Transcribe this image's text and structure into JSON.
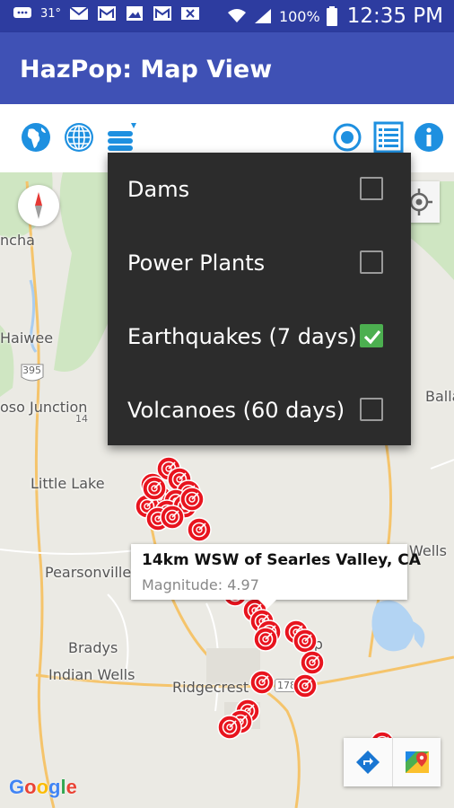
{
  "status_bar": {
    "temperature": "31°",
    "battery": "100%",
    "time": "12:35 PM"
  },
  "app_bar": {
    "title": "HazPop: Map View"
  },
  "toolbar": {
    "left_icons": [
      "globe-africa-icon",
      "globe-grid-icon",
      "layers-icon"
    ],
    "right_icons": [
      "target-icon",
      "list-icon",
      "info-icon"
    ],
    "accent_color": "#1e90e0"
  },
  "layers_menu": {
    "items": [
      {
        "label": "Dams",
        "checked": false
      },
      {
        "label": "Power Plants",
        "checked": false
      },
      {
        "label": "Earthquakes (7 days)",
        "checked": true
      },
      {
        "label": "Volcanoes (60 days)",
        "checked": false
      }
    ]
  },
  "map": {
    "places": [
      "ncha",
      "Haiwee",
      "oso Junction",
      "Little Lake",
      "Pearsonville",
      "Bradys",
      "Indian Wells",
      "Ridgecrest",
      "Balla",
      "Wells",
      "op"
    ],
    "route_shields": [
      "395",
      "14",
      "178"
    ],
    "info_window": {
      "title": "14km WSW of Searles Valley, CA",
      "subtitle": "Magnitude: 4.97"
    },
    "marker_color": "#e8141e",
    "logo": "Google"
  }
}
